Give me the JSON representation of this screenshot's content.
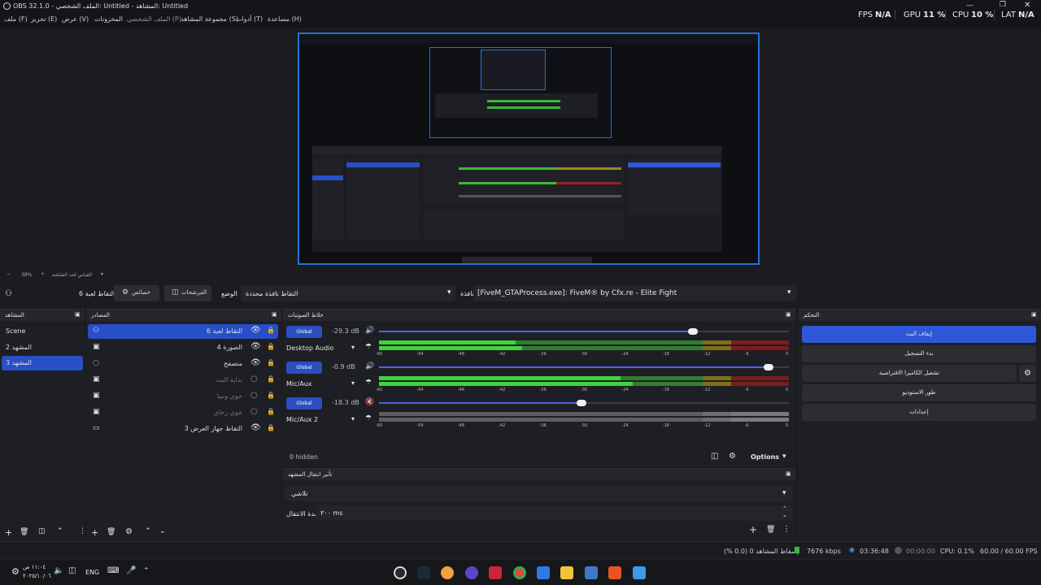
{
  "titlebar": {
    "title": "OBS 32.1.0 - الملف الشخصي: Untitled - المشاهد: Untitled"
  },
  "menu": [
    "ملف (F)",
    "تحرير (E)",
    "عرض (V)",
    "المخزونات",
    "الملف الشخصي (P)",
    "مجموعة المشاهد (S)",
    "أدوات (T)",
    "مساعدة (H)"
  ],
  "stats": {
    "fps_label": "FPS",
    "fps_value": "N/A",
    "gpu_label": "GPU",
    "gpu_value": "11 %",
    "cpu_label": "CPU",
    "cpu_value": "10 %",
    "lat_label": "LAT",
    "lat_value": "N/A"
  },
  "zoom": {
    "value": "38%",
    "hint": "القياس لحد الشاشة"
  },
  "scene_toolbar": {
    "source_name": "التقاط لعبة 6",
    "properties": "خصائص",
    "filters": "المرشحات",
    "mode_label": "الوضع",
    "mode_value": "التقاط نافذة محددة",
    "window_label": "نافذة",
    "window_value": "[FiveM_GTAProcess.exe]: FiveM® by Cfx.re - Elite Fight"
  },
  "scenes": {
    "title": "المشاهد",
    "items": [
      "Scene",
      "المشهد 2",
      "المشهد 3"
    ],
    "selected": 2
  },
  "sources": {
    "title": "المصادر",
    "items": [
      "التقاط لعبة 6",
      "الصورة 4",
      "متصفح",
      "بداية البث",
      "خوي ونبيا",
      "خوي رجاي",
      "التقاط جهاز العرض 3"
    ]
  },
  "mixer": {
    "title": "خلاط الصوتيات",
    "hidden": "0 hidden",
    "options": "Options",
    "ticks": [
      "-60",
      "-54",
      "-48",
      "-42",
      "-36",
      "-30",
      "-24",
      "-18",
      "-12",
      "-6",
      "0"
    ],
    "channels": [
      {
        "name": "Desktop Audio",
        "global": "Global",
        "db": "-29.3 dB",
        "volume": 0.79,
        "level": 0.35
      },
      {
        "name": "Mic/Aux",
        "global": "Global",
        "db": "-0.9 dB",
        "volume": 0.98,
        "level": 0.62
      },
      {
        "name": "Mic/Aux 2",
        "global": "Global",
        "db": "-18.3 dB",
        "volume": 0.51,
        "level": 0.0
      }
    ]
  },
  "transitions": {
    "title": "تأثير انتقال المشهد",
    "value": "تلاشي",
    "duration_label": "مدة الانتقال",
    "duration_value": "٣٠٠ ms"
  },
  "controls": {
    "title": "التحكم",
    "buttons": [
      "إيقاف البث",
      "بدء التسجيل",
      "تشغيل الكاميرا الافتراضية",
      "طور الاستوديو",
      "إعدادات"
    ]
  },
  "status": {
    "dropped": "إسقاط المشاهد 0 (0.0 %)",
    "kbps": "7676 kbps",
    "stream_time": "03:36:48",
    "rec_time": "00:00:00",
    "cpu": "CPU: 0.1%",
    "fps": "60.00 / 60.00 FPS"
  },
  "taskbar": {
    "time": "١١:٠٤ ص",
    "date": "٢٠٢٥/١٠/٠٦",
    "lang": "ENG"
  },
  "colors": {
    "accent": "#2e57d8",
    "green": "#3db83d",
    "yellow": "#9a8b1e",
    "red": "#9b1f1f"
  }
}
